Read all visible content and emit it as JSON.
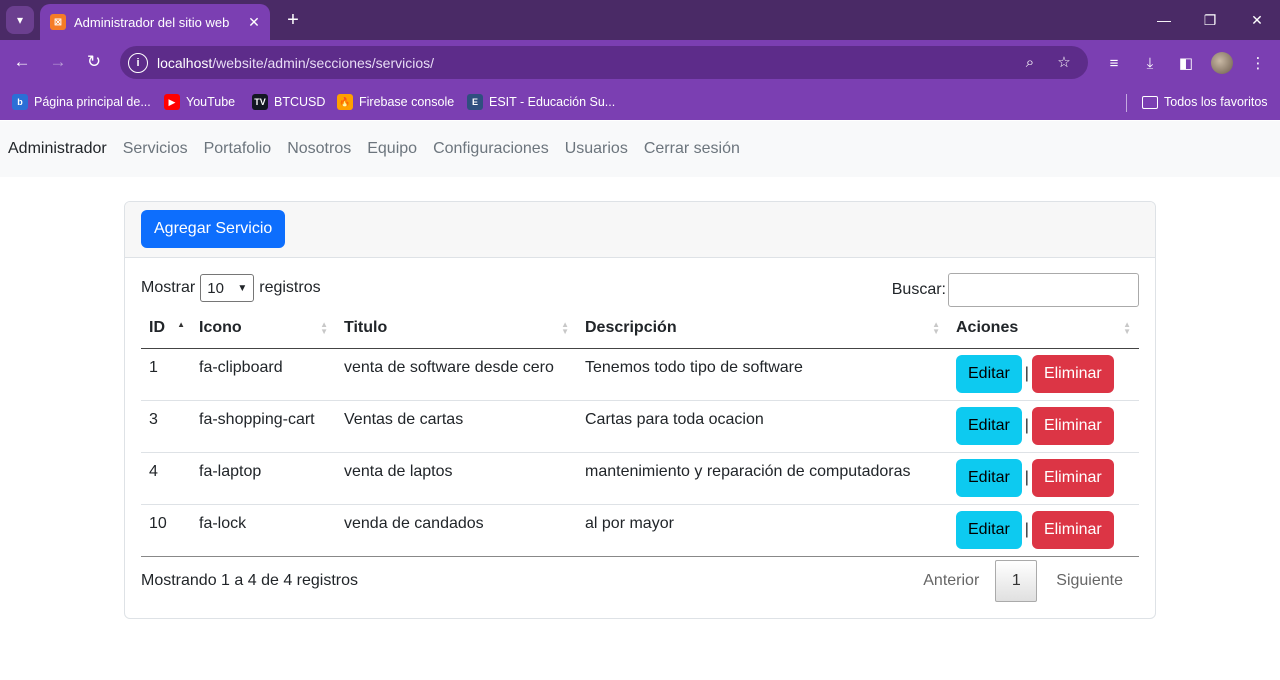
{
  "browser": {
    "tab_title": "Administrador del sitio web",
    "url_host": "localhost",
    "url_path": "/website/admin/secciones/servicios/",
    "bookmarks": [
      {
        "label": "Página principal de...",
        "icon": "bing-icon",
        "color": "#2b6fd6"
      },
      {
        "label": "YouTube",
        "icon": "youtube-icon",
        "color": "#ff0000"
      },
      {
        "label": "BTCUSD",
        "icon": "tradingview-icon",
        "color": "#131722"
      },
      {
        "label": "Firebase console",
        "icon": "firebase-icon",
        "color": "#ffa000"
      },
      {
        "label": "ESIT - Educación Su...",
        "icon": "esit-icon",
        "color": "#2f4f7f"
      }
    ],
    "all_bookmarks": "Todos los favoritos"
  },
  "navbar": {
    "brand": "Administrador",
    "links": [
      "Servicios",
      "Portafolio",
      "Nosotros",
      "Equipo",
      "Configuraciones",
      "Usuarios",
      "Cerrar sesión"
    ]
  },
  "card": {
    "add_button": "Agregar Servicio",
    "length_prefix": "Mostrar",
    "length_value": "10",
    "length_suffix": "registros",
    "search_label": "Buscar:",
    "columns": [
      "ID",
      "Icono",
      "Titulo",
      "Descripción",
      "Aciones"
    ],
    "rows": [
      {
        "id": "1",
        "icono": "fa-clipboard",
        "titulo": "venta de software desde cero",
        "descripcion": "Tenemos todo tipo de software"
      },
      {
        "id": "3",
        "icono": "fa-shopping-cart",
        "titulo": "Ventas de cartas",
        "descripcion": "Cartas para toda ocacion"
      },
      {
        "id": "4",
        "icono": "fa-laptop",
        "titulo": "venta de laptos",
        "descripcion": "mantenimiento y reparación de computadoras"
      },
      {
        "id": "10",
        "icono": "fa-lock",
        "titulo": "venda de candados",
        "descripcion": "al por mayor"
      }
    ],
    "edit_label": "Editar",
    "delete_label": "Eliminar",
    "separator": "|",
    "info": "Mostrando 1 a 4 de 4 registros",
    "prev_label": "Anterior",
    "current_page": "1",
    "next_label": "Siguiente"
  }
}
